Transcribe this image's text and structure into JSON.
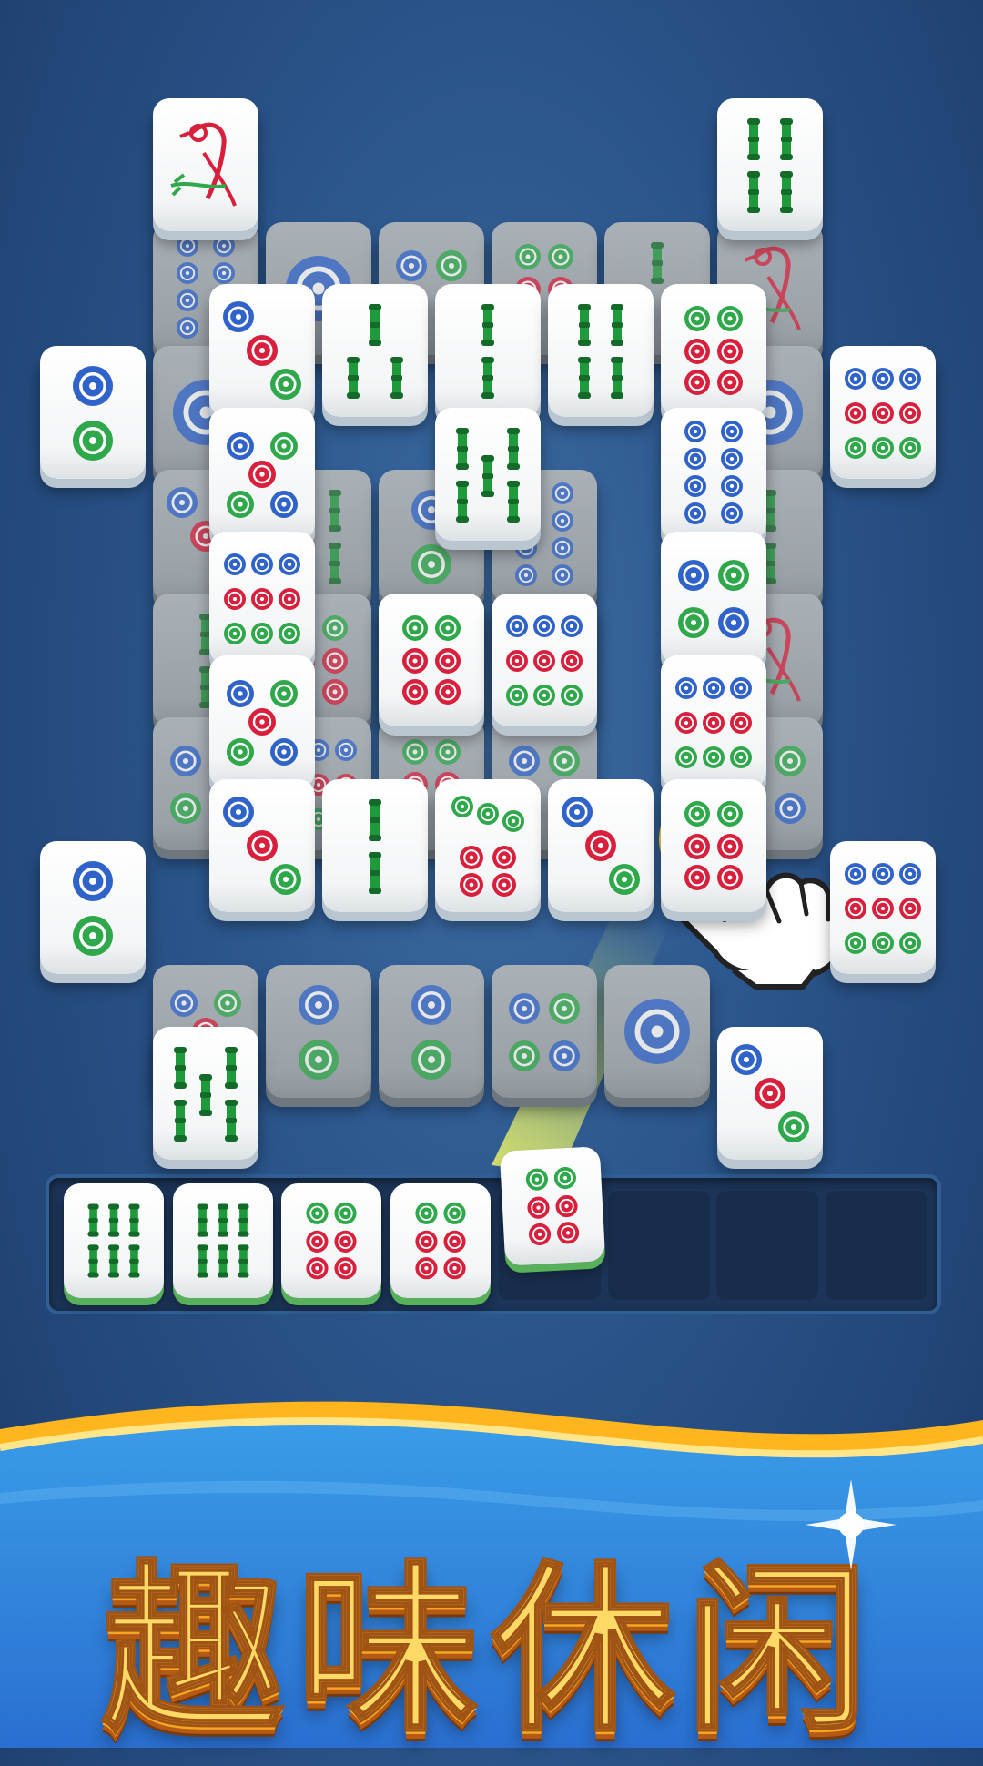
{
  "title": "趣味休闲",
  "colors": {
    "blue": "#2f63c9",
    "red": "#d8203c",
    "green": "#2ea84a",
    "bamboo": "#1f9a3a",
    "accent": "#ffd23d"
  },
  "board": {
    "tiles": [
      {
        "row": 0,
        "col": 0,
        "face": "bird",
        "dim": false
      },
      {
        "row": 0,
        "col": 10,
        "face": "bamboo-4",
        "dim": false
      },
      {
        "row": 1,
        "col": 0,
        "face": "dots-8",
        "dim": true
      },
      {
        "row": 1,
        "col": 2,
        "face": "dots-1",
        "dim": true
      },
      {
        "row": 1,
        "col": 4,
        "face": "dots-4",
        "dim": true
      },
      {
        "row": 1,
        "col": 6,
        "face": "dots-6",
        "dim": true
      },
      {
        "row": 1,
        "col": 8,
        "face": "bamboo-3",
        "dim": true
      },
      {
        "row": 1,
        "col": 10,
        "face": "bird",
        "dim": true
      },
      {
        "row": 2,
        "col": -2,
        "face": "dots-2",
        "dim": false
      },
      {
        "row": 2,
        "col": 0,
        "face": "dots-1",
        "dim": true
      },
      {
        "row": 2,
        "col": 10,
        "face": "dots-1",
        "dim": true
      },
      {
        "row": 2,
        "col": 12,
        "face": "dots-9",
        "dim": false
      },
      {
        "row": 3,
        "col": 0,
        "face": "dots-3",
        "dim": true
      },
      {
        "row": 3,
        "col": 10,
        "face": "bamboo-2",
        "dim": true
      },
      {
        "row": 4,
        "col": 0,
        "face": "bamboo-2",
        "dim": true
      },
      {
        "row": 4,
        "col": 10,
        "face": "bird",
        "dim": true
      },
      {
        "row": 5,
        "col": 0,
        "face": "dots-4",
        "dim": true
      },
      {
        "row": 5,
        "col": 10,
        "face": "dots-4",
        "dim": true
      },
      {
        "row": 6,
        "col": -2,
        "face": "dots-2",
        "dim": false
      },
      {
        "row": 6,
        "col": 12,
        "face": "dots-9",
        "dim": false
      },
      {
        "row": 7,
        "col": 0,
        "face": "dots-5",
        "dim": true
      },
      {
        "row": 7,
        "col": 2,
        "face": "dots-2",
        "dim": true
      },
      {
        "row": 7,
        "col": 4,
        "face": "dots-2",
        "dim": true
      },
      {
        "row": 7,
        "col": 6,
        "face": "dots-4",
        "dim": true
      },
      {
        "row": 7,
        "col": 8,
        "face": "dots-1",
        "dim": true
      },
      {
        "row": 3,
        "col": 2,
        "face": "bamboo-4",
        "dim": true
      },
      {
        "row": 3,
        "col": 4,
        "face": "dots-2",
        "dim": true
      },
      {
        "row": 3,
        "col": 6,
        "face": "dots-8",
        "dim": true
      },
      {
        "row": 4,
        "col": 2,
        "face": "dots-6",
        "dim": true
      },
      {
        "row": 4,
        "col": 4,
        "face": "dots-1",
        "dim": true
      },
      {
        "row": 4,
        "col": 6,
        "face": "dots-8",
        "dim": true
      },
      {
        "row": 5,
        "col": 2,
        "face": "dots-9",
        "dim": true
      },
      {
        "row": 5,
        "col": 4,
        "face": "dots-6",
        "dim": true
      },
      {
        "row": 5,
        "col": 6,
        "face": "dots-4",
        "dim": true
      },
      {
        "row": 1.5,
        "col": 1,
        "face": "dots-3",
        "dim": false
      },
      {
        "row": 1.5,
        "col": 3,
        "face": "bamboo-3",
        "dim": false
      },
      {
        "row": 1.5,
        "col": 5,
        "face": "bamboo-2",
        "dim": false
      },
      {
        "row": 1.5,
        "col": 7,
        "face": "bamboo-4",
        "dim": false
      },
      {
        "row": 1.5,
        "col": 9,
        "face": "dots-6",
        "dim": false
      },
      {
        "row": 2.5,
        "col": 1,
        "face": "dots-5",
        "dim": false
      },
      {
        "row": 2.5,
        "col": 5,
        "face": "bamboo-5",
        "dim": false
      },
      {
        "row": 2.5,
        "col": 9,
        "face": "dots-8",
        "dim": false
      },
      {
        "row": 3.5,
        "col": 1,
        "face": "dots-9",
        "dim": false
      },
      {
        "row": 3.5,
        "col": 9,
        "face": "dots-4",
        "dim": false
      },
      {
        "row": 4.5,
        "col": 1,
        "face": "dots-5",
        "dim": false
      },
      {
        "row": 4.5,
        "col": 9,
        "face": "dots-9",
        "dim": false
      },
      {
        "row": 5.5,
        "col": 1,
        "face": "dots-3",
        "dim": false
      },
      {
        "row": 5.5,
        "col": 3,
        "face": "bamboo-2",
        "dim": false
      },
      {
        "row": 5.5,
        "col": 5,
        "face": "dots-7",
        "dim": false
      },
      {
        "row": 5.5,
        "col": 7,
        "face": "dots-3",
        "dim": false
      },
      {
        "row": 5.5,
        "col": 9,
        "face": "dots-6",
        "dim": false
      },
      {
        "row": 4,
        "col": 4,
        "face": "dots-6",
        "dim": false
      },
      {
        "row": 4,
        "col": 6,
        "face": "dots-9",
        "dim": false
      },
      {
        "row": 7.5,
        "col": 0,
        "face": "bamboo-5",
        "dim": false
      },
      {
        "row": 7.5,
        "col": 10,
        "face": "dots-3",
        "dim": false
      }
    ]
  },
  "tray": {
    "slots": 8,
    "filled": [
      {
        "face": "bamboo-6"
      },
      {
        "face": "bamboo-6"
      },
      {
        "face": "dots-6"
      },
      {
        "face": "dots-6"
      }
    ],
    "incoming": {
      "face": "dots-6"
    }
  },
  "hint": {
    "icon": "pointing-hand-icon"
  }
}
